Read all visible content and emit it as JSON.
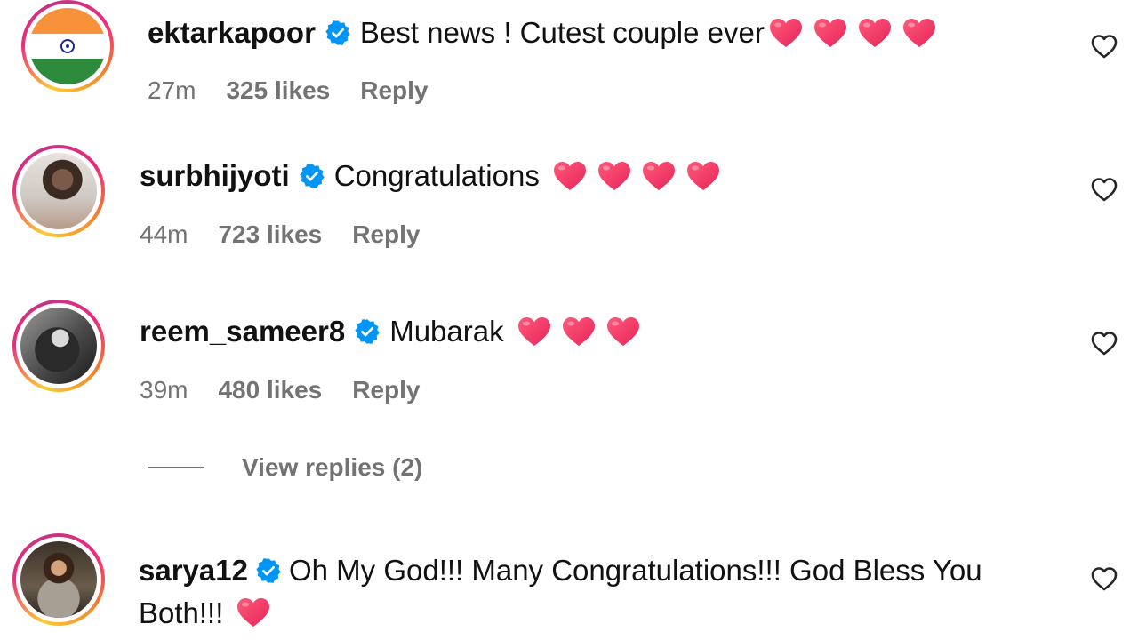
{
  "comments": [
    {
      "username": "ektarkapoor",
      "text": "Best news ! Cutest couple ever",
      "time": "27m",
      "likes": "325 likes",
      "reply": "Reply",
      "hearts": 4,
      "avatar": "india-flag"
    },
    {
      "username": "surbhijyoti",
      "text": "Congratulations",
      "time": "44m",
      "likes": "723 likes",
      "reply": "Reply",
      "hearts": 4,
      "avatar": "photo"
    },
    {
      "username": "reem_sameer8",
      "text": "Mubarak",
      "time": "39m",
      "likes": "480 likes",
      "reply": "Reply",
      "hearts": 3,
      "avatar": "photo-bw"
    },
    {
      "username": "sarya12",
      "text": "Oh My God!!! Many Congratulations!!! God Bless You Both!!!",
      "hearts": 1,
      "avatar": "photo"
    }
  ],
  "view_replies": "View replies (2)",
  "colors": {
    "verified": "#0095f6",
    "heart": "#f0426a",
    "meta": "#737373"
  },
  "icons": {
    "verified": "verified-badge-icon",
    "like": "heart-outline-icon",
    "emoji": "red-heart-emoji"
  }
}
